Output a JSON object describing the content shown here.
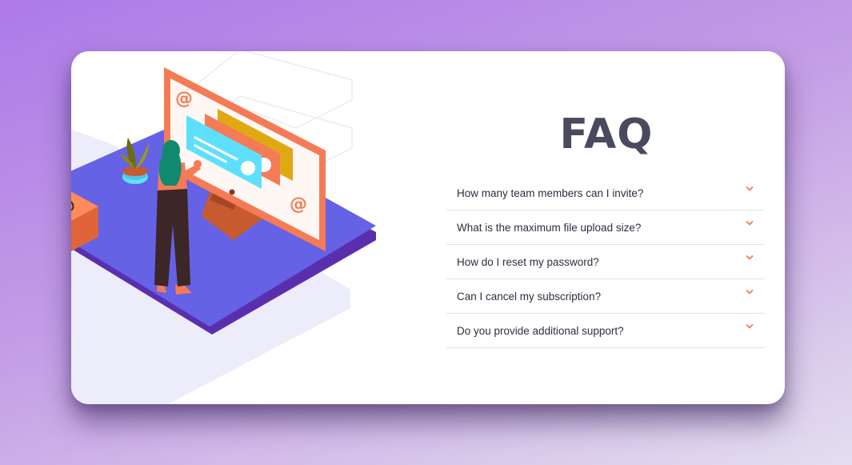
{
  "title": "FAQ",
  "faq": {
    "items": [
      {
        "question": "How many team members can I invite?"
      },
      {
        "question": "What is the maximum file upload size?"
      },
      {
        "question": "How do I reset my password?"
      },
      {
        "question": "Can I cancel my subscription?"
      },
      {
        "question": "Do you provide additional support?"
      }
    ]
  },
  "icons": {
    "toggle": "chevron-down-icon",
    "illustration_symbol": "at-sign-icon"
  },
  "colors": {
    "accent": "#f47b56",
    "platform": "#6562e5",
    "title": "#4a4a5f",
    "screen_accent_cyan": "#5ee0fc",
    "screen_accent_yellow": "#e0a813"
  }
}
